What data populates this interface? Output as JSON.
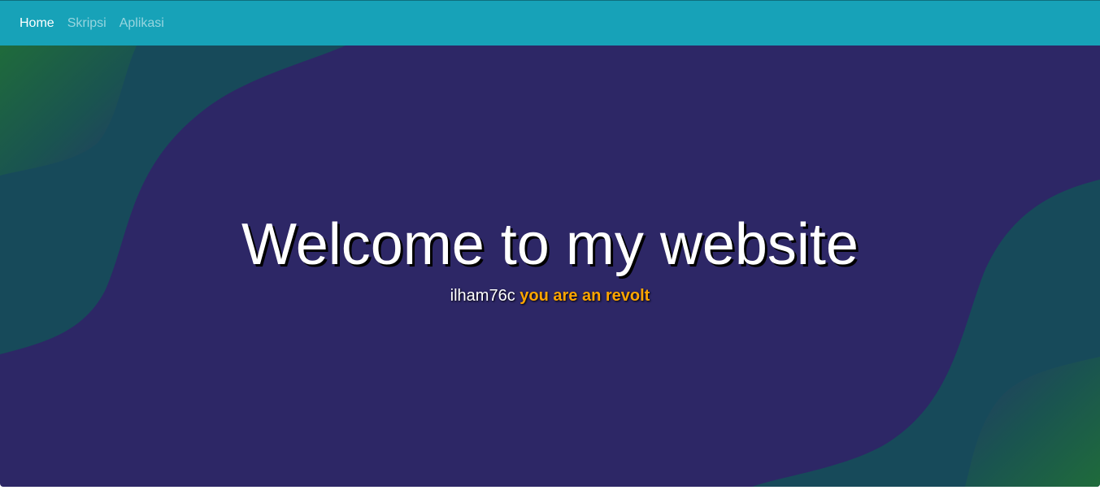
{
  "nav": {
    "items": [
      {
        "label": "Home",
        "active": true
      },
      {
        "label": "Skripsi",
        "active": false
      },
      {
        "label": "Aplikasi",
        "active": false
      }
    ]
  },
  "hero": {
    "title": "Welcome to my website",
    "subtitle_name": "ilham76c",
    "subtitle_accent": "you are an revolt"
  },
  "colors": {
    "navbar": "#17a2b8",
    "hero_bg": "#2d2766",
    "wave_green": "#1e6b3a",
    "wave_teal": "#174a5a",
    "accent": "#ffa500"
  }
}
